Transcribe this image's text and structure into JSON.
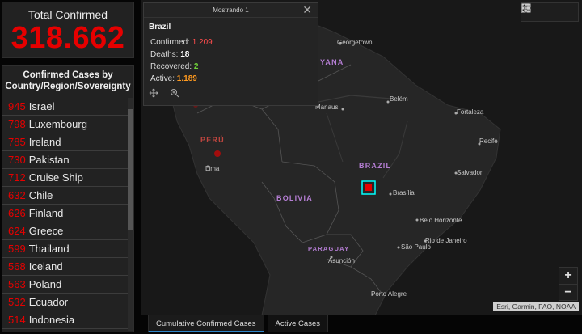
{
  "total": {
    "label": "Total Confirmed",
    "value": "318.662"
  },
  "cases": {
    "header": "Confirmed Cases by Country/Region/Sovereignty",
    "rows": [
      {
        "count": "945",
        "name": "Israel"
      },
      {
        "count": "798",
        "name": "Luxembourg"
      },
      {
        "count": "785",
        "name": "Ireland"
      },
      {
        "count": "730",
        "name": "Pakistan"
      },
      {
        "count": "712",
        "name": "Cruise Ship"
      },
      {
        "count": "632",
        "name": "Chile"
      },
      {
        "count": "626",
        "name": "Finland"
      },
      {
        "count": "624",
        "name": "Greece"
      },
      {
        "count": "599",
        "name": "Thailand"
      },
      {
        "count": "568",
        "name": "Iceland"
      },
      {
        "count": "563",
        "name": "Poland"
      },
      {
        "count": "532",
        "name": "Ecuador"
      },
      {
        "count": "514",
        "name": "Indonesia"
      }
    ]
  },
  "popup": {
    "count_text": "Mostrando 1",
    "close_icon": "close-icon",
    "title": "Brazil",
    "fields": {
      "confirmed_label": "Confirmed:",
      "confirmed_value": "1.209",
      "deaths_label": "Deaths:",
      "deaths_value": "18",
      "recovered_label": "Recovered:",
      "recovered_value": "2",
      "active_label": "Active:",
      "active_value": "1.189"
    },
    "tools": [
      "move-icon",
      "zoom-to-icon"
    ]
  },
  "map": {
    "labels": {
      "georgetown": "Georgetown",
      "yana": "YANA",
      "manaus": "Manaus",
      "belem": "Belém",
      "fortaleza": "Fortaleza",
      "recife": "Recife",
      "salvador": "Salvador",
      "brasilia": "Brasília",
      "belo_horizonte": "Belo Horizonte",
      "rio": "Rio de Janeiro",
      "sao_paulo": "São Paulo",
      "porto_alegre": "Porto Alegre",
      "lima": "Lima",
      "asuncion": "Asunción",
      "peru": "PERÚ",
      "brazil": "BRAZIL",
      "bolivia": "BOLIVIA",
      "paraguay": "PARAGUAY"
    },
    "zoom_in": "+",
    "zoom_out": "−",
    "attribution": "Esri, Garmin, FAO, NOAA",
    "top_buttons": [
      "bookmark-icon",
      "list-icon",
      "grid-icon"
    ],
    "colors": {
      "marker": "#e60000",
      "selection": "#00ffff"
    }
  },
  "tabs": [
    {
      "label": "Cumulative Confirmed Cases",
      "active": true
    },
    {
      "label": "Active Cases",
      "active": false
    }
  ]
}
